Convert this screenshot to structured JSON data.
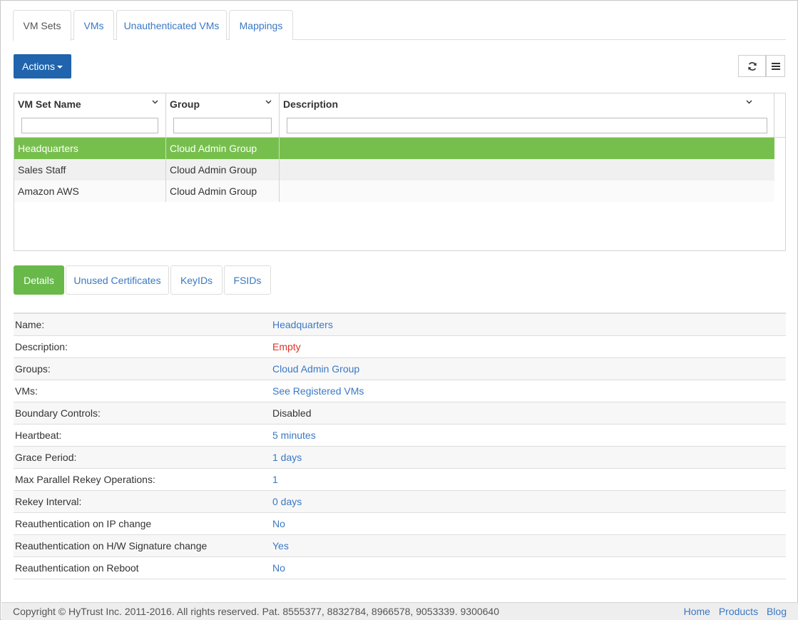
{
  "top_tabs": [
    {
      "label": "VM Sets",
      "active": true
    },
    {
      "label": "VMs",
      "active": false
    },
    {
      "label": "Unauthenticated VMs",
      "active": false
    },
    {
      "label": "Mappings",
      "active": false
    }
  ],
  "toolbar": {
    "actions_label": "Actions",
    "refresh_icon": "refresh-icon",
    "menu_icon": "list-menu-icon"
  },
  "grid": {
    "columns": [
      "VM Set Name",
      "Group",
      "Description"
    ],
    "rows": [
      {
        "name": "Headquarters",
        "group": "Cloud Admin Group",
        "description": "",
        "selected": true
      },
      {
        "name": "Sales Staff",
        "group": "Cloud Admin Group",
        "description": "",
        "selected": false
      },
      {
        "name": "Amazon AWS",
        "group": "Cloud Admin Group",
        "description": "",
        "selected": false
      }
    ]
  },
  "detail_tabs": [
    {
      "label": "Details",
      "active": true
    },
    {
      "label": "Unused Certificates",
      "active": false
    },
    {
      "label": "KeyIDs",
      "active": false
    },
    {
      "label": "FSIDs",
      "active": false
    }
  ],
  "details": [
    {
      "label": "Name:",
      "value": "Headquarters",
      "style": "link"
    },
    {
      "label": "Description:",
      "value": "Empty",
      "style": "red"
    },
    {
      "label": "Groups:",
      "value": "Cloud Admin Group",
      "style": "link"
    },
    {
      "label": "VMs:",
      "value": "See Registered VMs",
      "style": "link"
    },
    {
      "label": "Boundary Controls:",
      "value": "Disabled",
      "style": "plain"
    },
    {
      "label": "Heartbeat:",
      "value": "5 minutes",
      "style": "link"
    },
    {
      "label": "Grace Period:",
      "value": "1 days",
      "style": "link"
    },
    {
      "label": "Max Parallel Rekey Operations:",
      "value": "1",
      "style": "link"
    },
    {
      "label": "Rekey Interval:",
      "value": "0 days",
      "style": "link"
    },
    {
      "label": "Reauthentication on IP change",
      "value": "No",
      "style": "link"
    },
    {
      "label": "Reauthentication on H/W Signature change",
      "value": "Yes",
      "style": "link"
    },
    {
      "label": "Reauthentication on Reboot",
      "value": "No",
      "style": "link"
    }
  ],
  "footer": {
    "copyright": "Copyright © HyTrust Inc. 2011-2016. All rights reserved. Pat. 8555377, 8832784, 8966578, 9053339. 9300640",
    "links": [
      "Home",
      "Products",
      "Blog"
    ]
  },
  "colors": {
    "accent_blue": "#1f64ac",
    "link_blue": "#3a78c4",
    "selected_green": "#77bf4d",
    "active_pill_green": "#68b84a",
    "empty_red": "#d9342b"
  }
}
